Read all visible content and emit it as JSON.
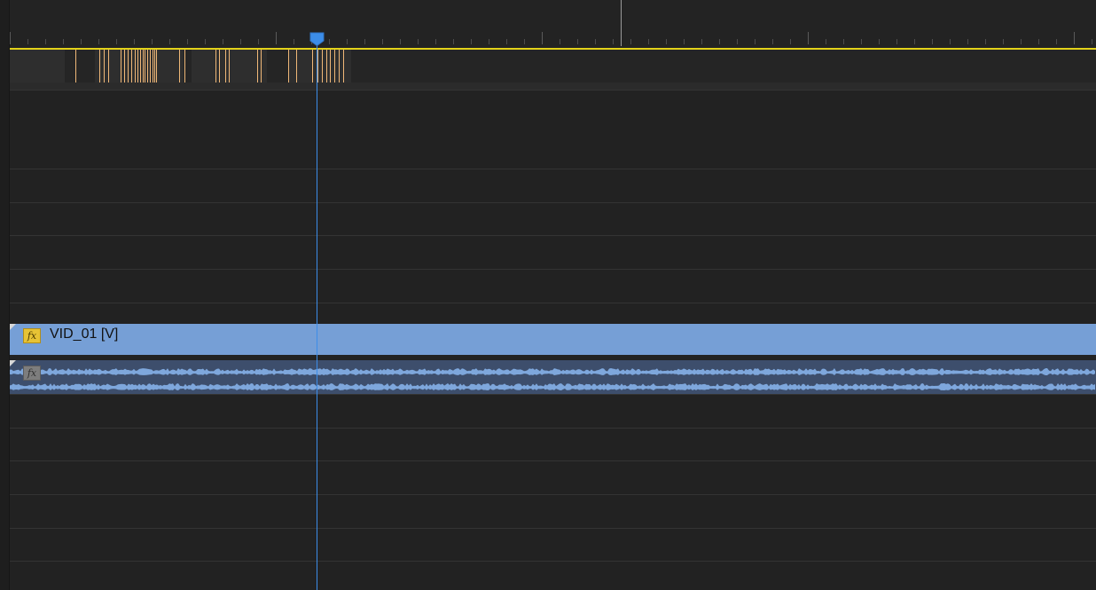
{
  "timeline": {
    "video_clip": {
      "name": "VID_01 [V]",
      "fx_label": "fx",
      "color": "#769fd6"
    },
    "audio_clip": {
      "fx_label": "fx",
      "color": "#3d4e6c",
      "waveform_color": "#7ea7dc"
    },
    "work_area_color": "#e3d21a",
    "marker_color": "#f0b878",
    "playhead_color": "#3c8de8",
    "icons": [
      "fx-badge-icon",
      "playhead-icon",
      "clip-corner-icon"
    ]
  }
}
